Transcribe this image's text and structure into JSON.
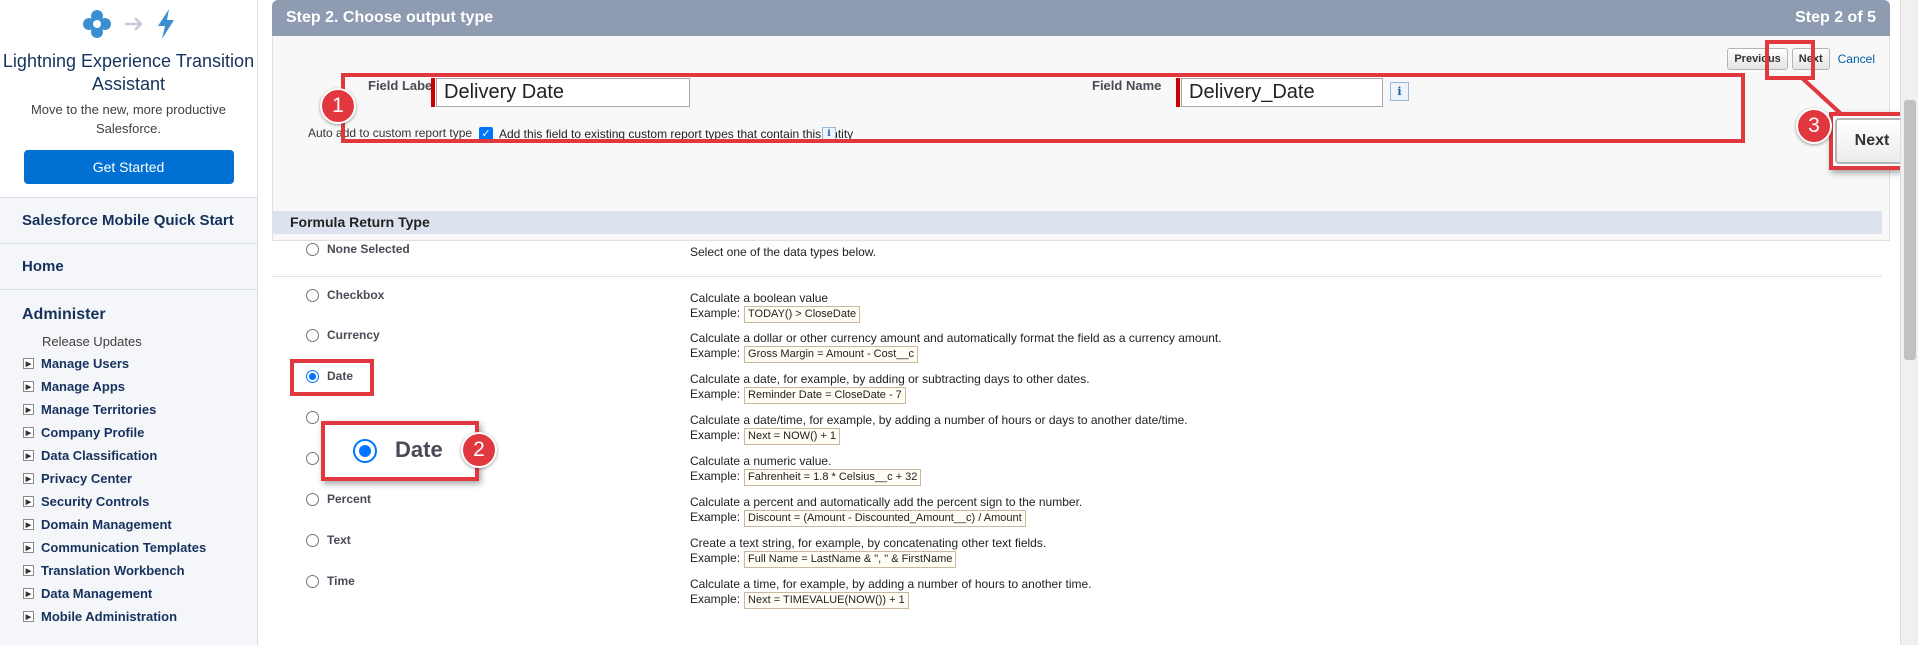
{
  "sidebar": {
    "promo_title": "Lightning Experience Transition Assistant",
    "promo_subtitle": "Move to the new, more productive Salesforce.",
    "get_started": "Get Started",
    "mobile_quick_start": "Salesforce Mobile Quick Start",
    "home": "Home",
    "administer": "Administer",
    "release_updates": "Release Updates",
    "items": [
      "Manage Users",
      "Manage Apps",
      "Manage Territories",
      "Company Profile",
      "Data Classification",
      "Privacy Center",
      "Security Controls",
      "Domain Management",
      "Communication Templates",
      "Translation Workbench",
      "Data Management",
      "Mobile Administration"
    ]
  },
  "header": {
    "step_title": "Step 2. Choose output type",
    "step_count": "Step 2 of 5"
  },
  "buttons": {
    "previous": "Previous",
    "next": "Next",
    "cancel": "Cancel"
  },
  "form": {
    "field_label_label": "Field Label",
    "field_label_value": "Delivery Date",
    "field_name_label": "Field Name",
    "field_name_value": "Delivery_Date",
    "info_glyph": "i",
    "auto_add_label": "Auto add to custom report type",
    "auto_add_text": "Add this field to existing custom report types that contain this entity",
    "auto_add_checked": true
  },
  "return_type": {
    "section_title": "Formula Return Type",
    "example_label": "Example:",
    "selected": "Date",
    "options": [
      {
        "name": "None Selected",
        "desc": "Select one of the data types below.",
        "example": ""
      },
      {
        "name": "Checkbox",
        "desc": "Calculate a boolean value",
        "example": "TODAY() > CloseDate"
      },
      {
        "name": "Currency",
        "desc": "Calculate a dollar or other currency amount and automatically format the field as a currency amount.",
        "example": "Gross Margin = Amount - Cost__c"
      },
      {
        "name": "Date",
        "desc": "Calculate a date, for example, by adding or subtracting days to other dates.",
        "example": "Reminder Date = CloseDate - 7"
      },
      {
        "name": "",
        "desc": "Calculate a date/time, for example, by adding a number of hours or days to another date/time.",
        "example": "Next = NOW() + 1"
      },
      {
        "name": "",
        "desc": "Calculate a numeric value.",
        "example": "Fahrenheit = 1.8 * Celsius__c + 32"
      },
      {
        "name": "Percent",
        "desc": "Calculate a percent and automatically add the percent sign to the number.",
        "example": "Discount = (Amount - Discounted_Amount__c) / Amount"
      },
      {
        "name": "Text",
        "desc": "Create a text string, for example, by concatenating other text fields.",
        "example": "Full Name = LastName & \", \" & FirstName"
      },
      {
        "name": "Time",
        "desc": "Calculate a time, for example, by adding a number of hours to another time.",
        "example": "Next = TIMEVALUE(NOW()) + 1"
      }
    ]
  },
  "annotations": {
    "badge1": "1",
    "badge2": "2",
    "badge3": "3",
    "zoom_date": "Date",
    "zoom_next": "Next",
    "color": "#e0383e"
  },
  "colors": {
    "step_bar": "#8e9bb0",
    "primary": "#0070d2",
    "section_head": "#dde3ee"
  }
}
